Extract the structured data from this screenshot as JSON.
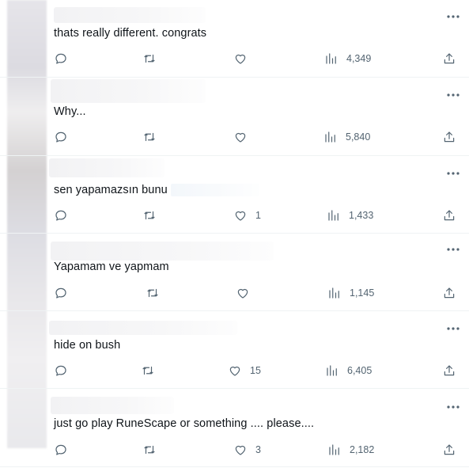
{
  "replies": [
    {
      "text": "thats really different. congrats",
      "likes": "",
      "views": "4,349"
    },
    {
      "text": "Why...",
      "likes": "",
      "views": "5,840"
    },
    {
      "text": "sen yapamazsın bunu",
      "likes": "1",
      "views": "1,433"
    },
    {
      "text": "Yapamam ve yapmam",
      "likes": "",
      "views": "1,145"
    },
    {
      "text": "hide on bush",
      "likes": "15",
      "views": "6,405"
    },
    {
      "text": "just go play RuneScape or something .... please....",
      "likes": "3",
      "views": "2,182"
    }
  ],
  "icons": {
    "more": "more-horizontal-icon",
    "reply": "reply-bubble-icon",
    "retweet": "retweet-icon",
    "like": "heart-icon",
    "views": "views-bar-chart-icon",
    "share": "share-upload-icon"
  },
  "colors": {
    "icon": "#536471",
    "text": "#0f1419",
    "divider": "#eff3f4"
  }
}
